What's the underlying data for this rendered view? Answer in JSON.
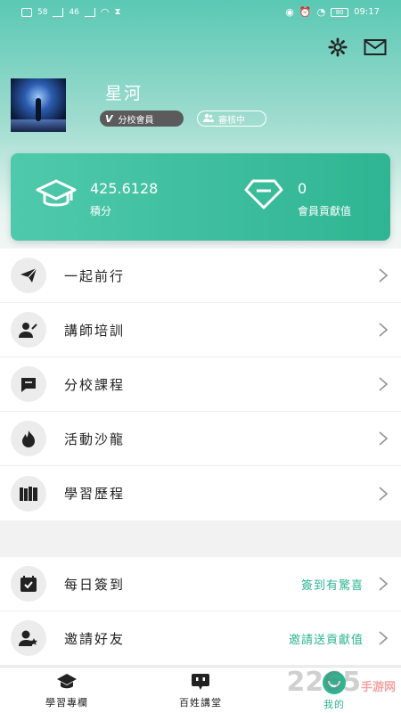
{
  "status_bar": {
    "left": [
      "58",
      "46"
    ],
    "time": "09:17",
    "battery": "80"
  },
  "profile": {
    "username": "星河",
    "badge_member": "分校會員",
    "badge_member_mark": "V",
    "badge_status": "審核中"
  },
  "stats": {
    "points_value": "425.6128",
    "points_label": "積分",
    "contribution_value": "0",
    "contribution_label": "會員貢獻值"
  },
  "menu_main": [
    {
      "label": "一起前行",
      "icon": "paper-plane-icon"
    },
    {
      "label": "講師培訓",
      "icon": "user-edit-icon"
    },
    {
      "label": "分校課程",
      "icon": "message-square-icon"
    },
    {
      "label": "活動沙龍",
      "icon": "flame-icon"
    },
    {
      "label": "學習歷程",
      "icon": "books-icon"
    }
  ],
  "menu_secondary": [
    {
      "label": "每日簽到",
      "right": "簽到有驚喜",
      "icon": "calendar-check-icon"
    },
    {
      "label": "邀請好友",
      "right": "邀請送貢獻值",
      "icon": "user-star-icon"
    }
  ],
  "tabbar": [
    {
      "label": "學習專欄",
      "icon": "graduation-cap-icon",
      "active": false
    },
    {
      "label": "百姓講堂",
      "icon": "chat-face-icon",
      "active": false
    },
    {
      "label": "我的",
      "icon": "profile-icon",
      "active": true
    }
  ],
  "watermark": {
    "text": "2265",
    "sub": "手游网"
  },
  "colors": {
    "accent": "#2db593",
    "card": "#3fc0a0"
  }
}
